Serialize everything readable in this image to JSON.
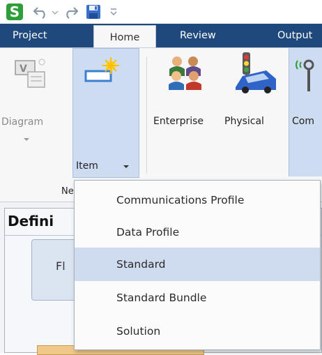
{
  "app": {
    "logo_letter": "S",
    "logo_color": "#2e9e3a",
    "accent": "#1f497d"
  },
  "quick_access": {
    "items": [
      "undo-icon",
      "undo-dropdown-icon",
      "redo-icon",
      "save-icon",
      "customize-toolbar-icon"
    ]
  },
  "tabs": [
    {
      "label": "Project",
      "active": false
    },
    {
      "label": "Home",
      "active": true
    },
    {
      "label": "Review",
      "active": false
    },
    {
      "label": "Output",
      "active": false
    }
  ],
  "ribbon": {
    "diagram_label": "Diagram",
    "item_label": "Item",
    "enterprise_label": "Enterprise",
    "physical_label": "Physical",
    "comms_label": "Com",
    "group_label": "Ne"
  },
  "document": {
    "heading": "Defini",
    "card_label": "Fl"
  },
  "menu": {
    "items": [
      {
        "label": "Communications Profile",
        "selected": false
      },
      {
        "label": "Data Profile",
        "selected": false
      },
      {
        "label": "Standard",
        "selected": true
      },
      {
        "label": "Standard Bundle",
        "selected": false
      },
      {
        "label": "Solution",
        "selected": false
      }
    ]
  }
}
